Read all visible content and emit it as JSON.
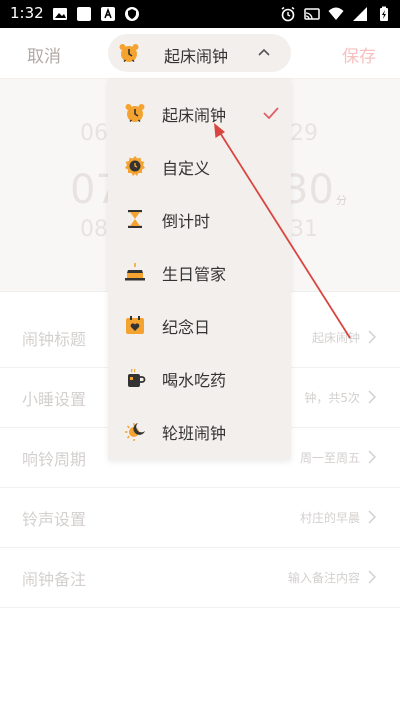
{
  "status_bar": {
    "time": "1:32",
    "left_icons": [
      "image-icon",
      "blank-square-icon",
      "a-letter-icon",
      "shield-icon"
    ],
    "right_icons": [
      "alarm-icon",
      "cast-icon",
      "wifi-icon",
      "signal-icon",
      "battery-charging-icon"
    ]
  },
  "header": {
    "cancel_label": "取消",
    "save_label": "保存",
    "selector_label": "起床闹钟"
  },
  "background_picker": {
    "faded_numbers": [
      "06",
      "29",
      "07",
      "30",
      "08",
      "31"
    ],
    "minute_unit": "分"
  },
  "settings": [
    {
      "label": "闹钟标题",
      "value": "起床闹钟"
    },
    {
      "label": "小睡设置",
      "value": "钟，共5次"
    },
    {
      "label": "响铃周期",
      "value": "周一至周五"
    },
    {
      "label": "铃声设置",
      "value": "村庄的早晨"
    },
    {
      "label": "闹钟备注",
      "value": "输入备注内容"
    }
  ],
  "dropdown": {
    "items": [
      {
        "label": "起床闹钟",
        "icon": "alarm-clock-icon",
        "selected": true
      },
      {
        "label": "自定义",
        "icon": "custom-clock-icon",
        "selected": false
      },
      {
        "label": "倒计时",
        "icon": "hourglass-icon",
        "selected": false
      },
      {
        "label": "生日管家",
        "icon": "birthday-cake-icon",
        "selected": false
      },
      {
        "label": "纪念日",
        "icon": "calendar-heart-icon",
        "selected": false
      },
      {
        "label": "喝水吃药",
        "icon": "cup-icon",
        "selected": false
      },
      {
        "label": "轮班闹钟",
        "icon": "sun-moon-icon",
        "selected": false
      }
    ]
  },
  "colors": {
    "accent_red": "#e06068",
    "icon_orange": "#f4a330",
    "menu_bg": "#f3efec"
  }
}
